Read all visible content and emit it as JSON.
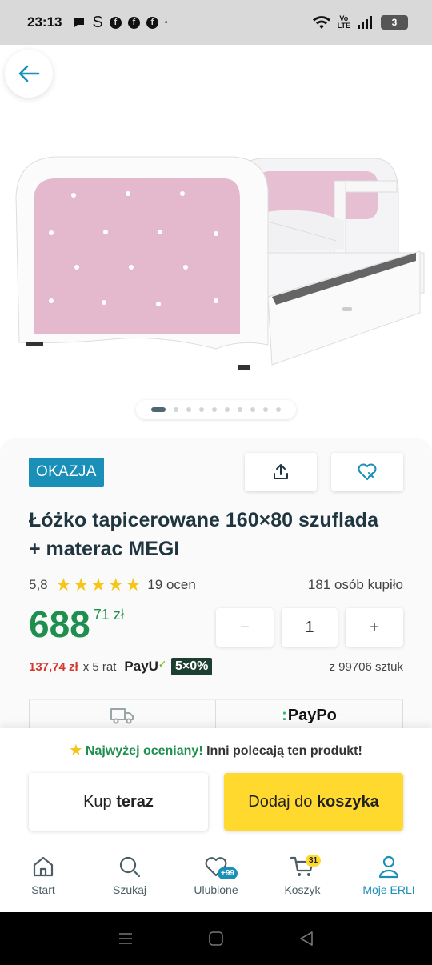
{
  "status_bar": {
    "time": "23:13",
    "s_glyph": "S",
    "fb_glyph": "f",
    "dot": "•",
    "volte_top": "Vo",
    "volte_bottom": "LTE",
    "battery": "3"
  },
  "gallery": {
    "slide_count": 10,
    "active_slide": 0
  },
  "product": {
    "badge": "OKAZJA",
    "title": "Łóżko tapicerowane 160×80 szuflada + materac MEGI",
    "rating_value": "5,8",
    "stars": 5,
    "reviews": "19 ocen",
    "bought": "181 osób kupiło",
    "price_main": "688",
    "price_cents": "71 zł",
    "quantity": "1",
    "minus": "−",
    "plus": "+",
    "installment_amount": "137,74 zł",
    "installment_rest": "x 5 rat",
    "payu_label": "PayU",
    "installment_badge": "5×0%",
    "stock": "z 99706 sztuk",
    "paypo": "PayPo",
    "paypo_mark": ":"
  },
  "sheet": {
    "promo_strong": "Najwyżej oceniany!",
    "promo_rest": "Inni polecają ten produkt!",
    "buy_now_a": "Kup",
    "buy_now_b": "teraz",
    "add_cart_a": "Dodaj do",
    "add_cart_b": "koszyka"
  },
  "nav": {
    "items": [
      {
        "label": "Start"
      },
      {
        "label": "Szukaj"
      },
      {
        "label": "Ulubione",
        "badge": "+99"
      },
      {
        "label": "Koszyk",
        "badge": "31"
      },
      {
        "label": "Moje ERLI"
      }
    ]
  },
  "colors": {
    "accent": "#1a8fb8",
    "price_green": "#1e8f4e",
    "cta_yellow": "#ffd92e",
    "installment_red": "#d4382f"
  }
}
